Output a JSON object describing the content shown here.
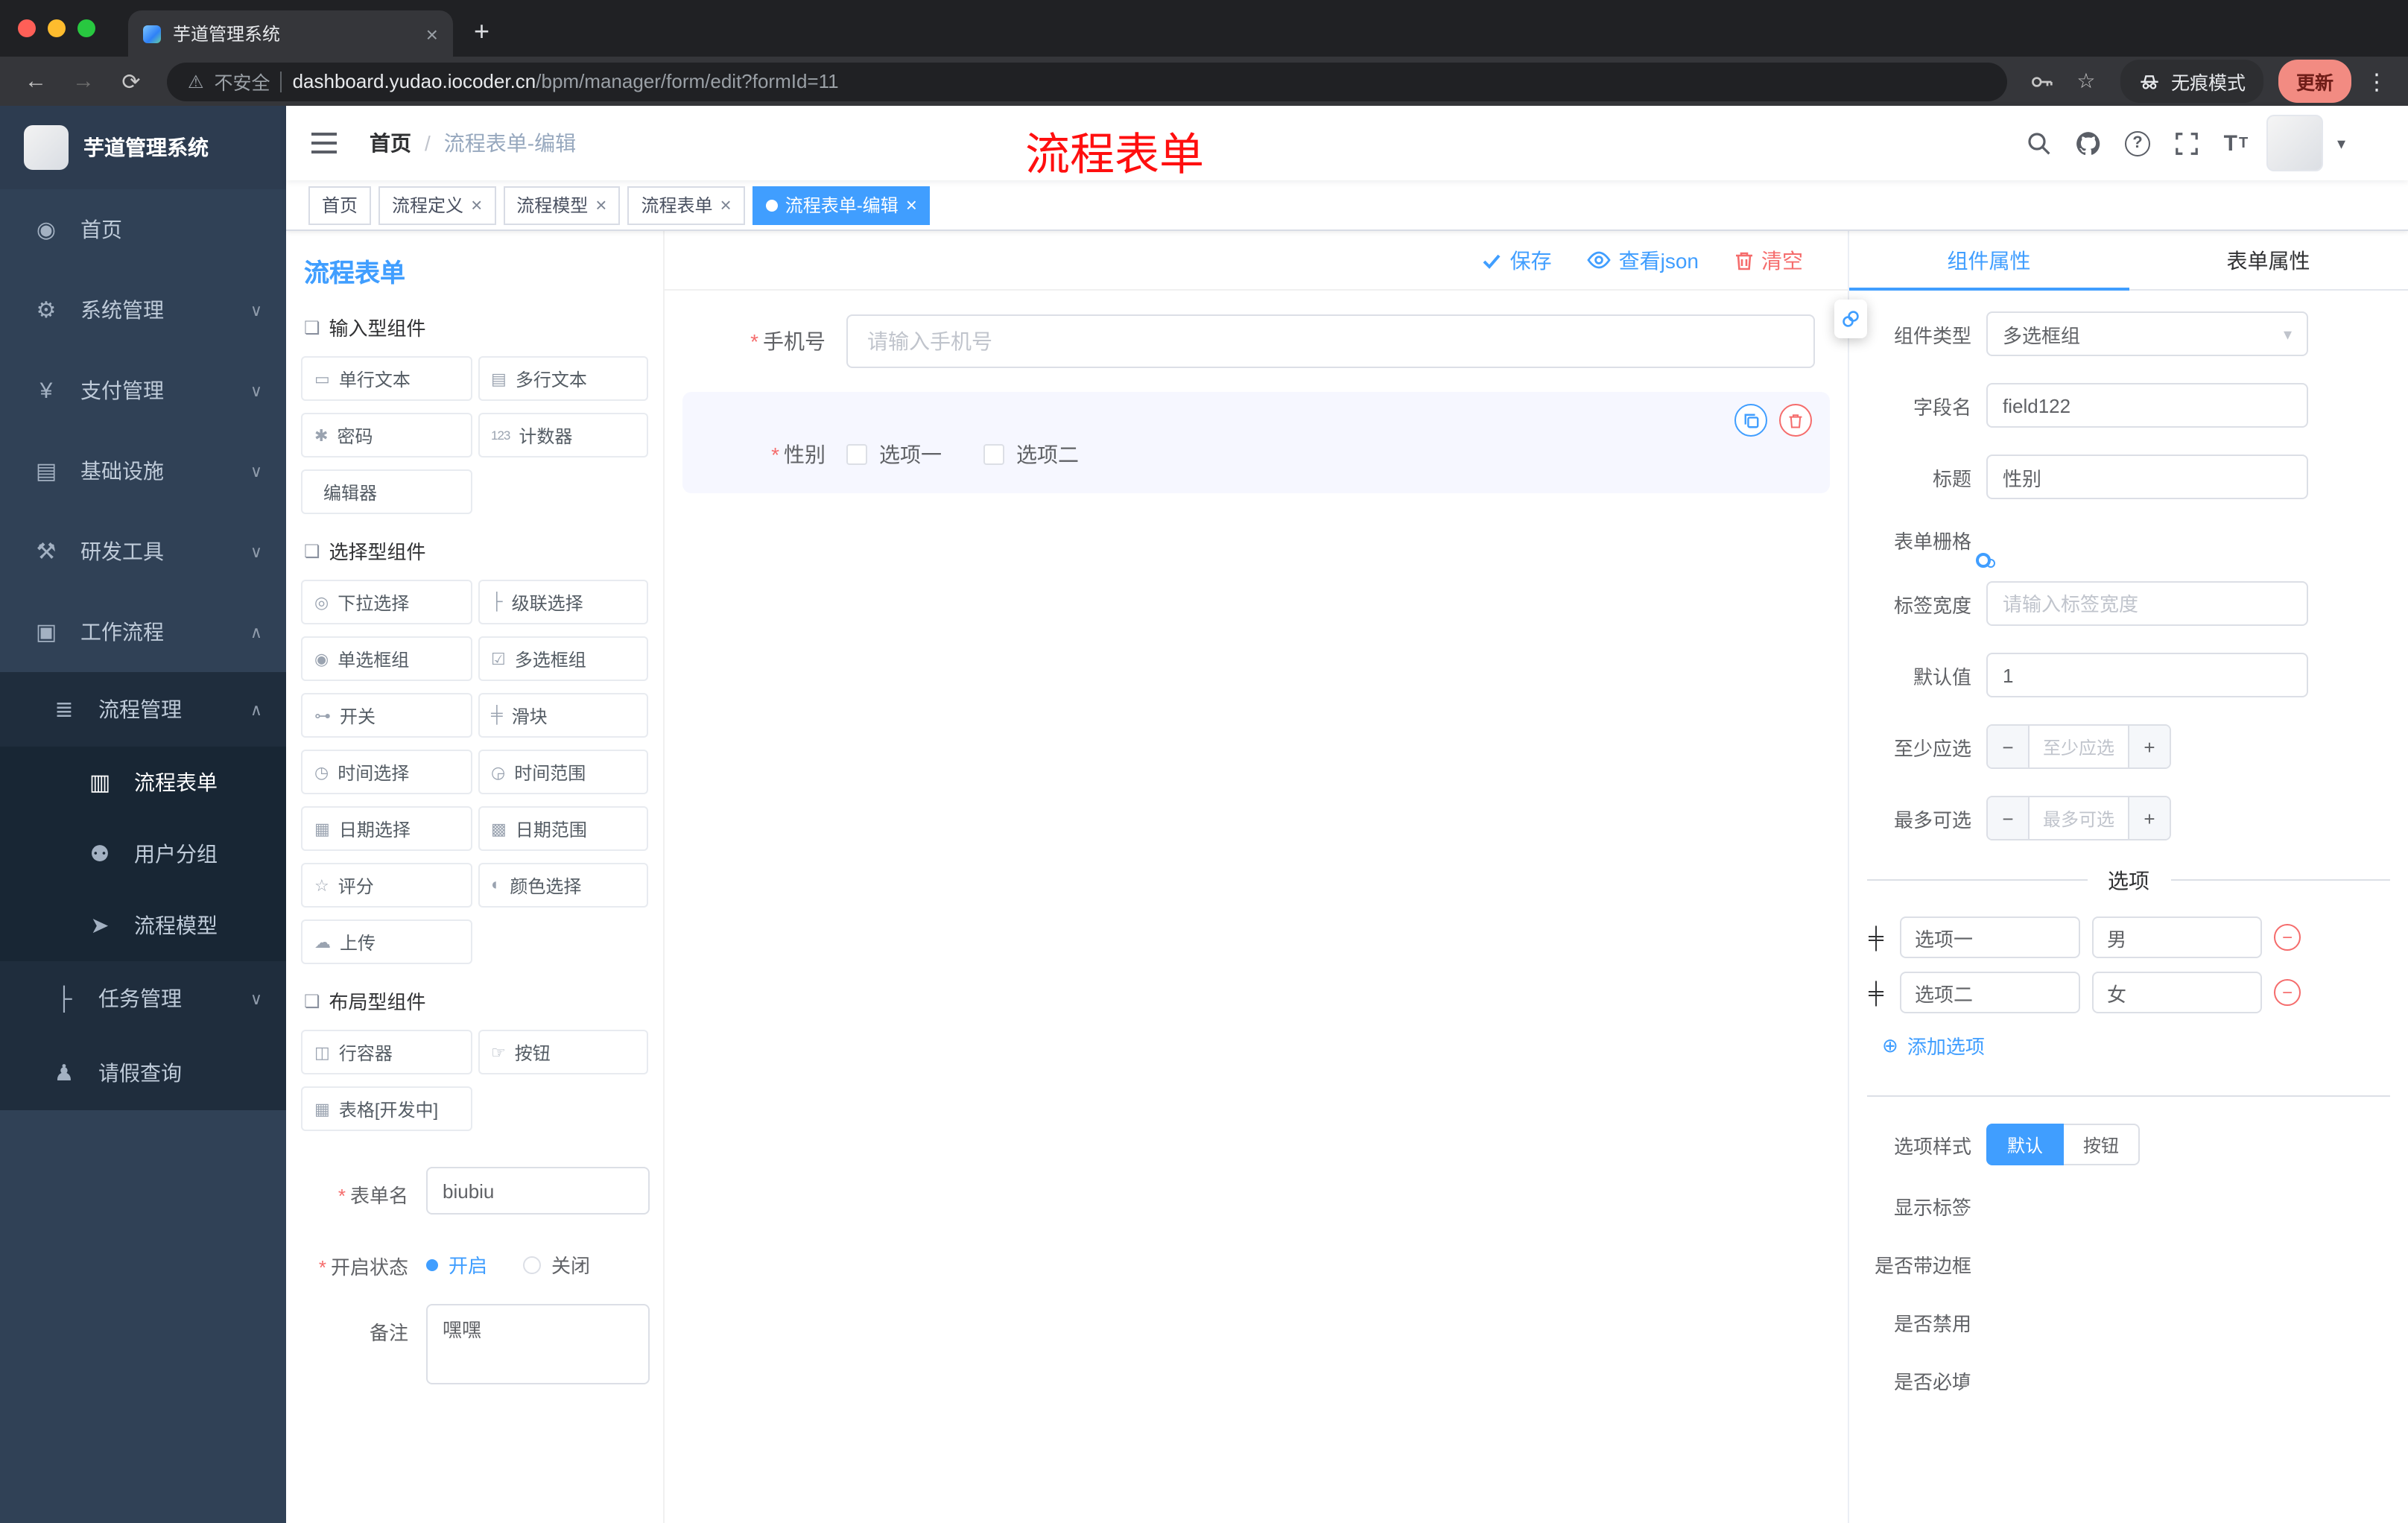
{
  "icons": {
    "close": "×",
    "new_tab": "+",
    "back": "←",
    "forward": "→",
    "reload": "⟳",
    "warning": "⚠",
    "star": "☆",
    "menu_dots": "⋮",
    "caret_down": "▾",
    "question": "?",
    "font_big": "T",
    "font_small": "T",
    "chevron_down": "∨",
    "chevron_up": "∧",
    "breadcrumb_sep": "/",
    "required": "*",
    "minus": "−",
    "plus": "+",
    "add_circle": "⊕",
    "remove_circle": "−",
    "drag_handle": "╪",
    "group_cube": "❏"
  },
  "browser": {
    "tab_title": "芋道管理系统",
    "security_label": "不安全",
    "url_host": "dashboard.yudao.iocoder.cn",
    "url_path": "/bpm/manager/form/edit?formId=11",
    "incognito_label": "无痕模式",
    "update_label": "更新"
  },
  "sidebar": {
    "logo_title": "芋道管理系统",
    "menu": [
      {
        "label": "首页",
        "icon": "◉"
      },
      {
        "label": "系统管理",
        "icon": "⚙"
      },
      {
        "label": "支付管理",
        "icon": "¥"
      },
      {
        "label": "基础设施",
        "icon": "▤"
      },
      {
        "label": "研发工具",
        "icon": "⚒"
      },
      {
        "label": "工作流程",
        "icon": "▣"
      }
    ],
    "submenu": [
      {
        "label": "流程管理",
        "icon": "≣"
      },
      {
        "label": "流程表单",
        "icon": "▥"
      },
      {
        "label": "用户分组",
        "icon": "⚉"
      },
      {
        "label": "流程模型",
        "icon": "➤"
      },
      {
        "label": "任务管理",
        "icon": "├"
      },
      {
        "label": "请假查询",
        "icon": "♟"
      }
    ]
  },
  "header": {
    "breadcrumb": [
      "首页",
      "流程表单-编辑"
    ],
    "annotation": "流程表单"
  },
  "tags": {
    "items": [
      {
        "label": "首页"
      },
      {
        "label": "流程定义"
      },
      {
        "label": "流程模型"
      },
      {
        "label": "流程表单"
      },
      {
        "label": "流程表单-编辑"
      }
    ]
  },
  "palette": {
    "title": "流程表单",
    "groups": [
      {
        "title": "输入型组件",
        "items": [
          {
            "icon": "▭",
            "label": "单行文本"
          },
          {
            "icon": "▤",
            "label": "多行文本"
          },
          {
            "icon": "✱",
            "label": "密码"
          },
          {
            "icon": "123",
            "label": "计数器"
          },
          {
            "icon": "",
            "label": "编辑器"
          }
        ]
      },
      {
        "title": "选择型组件",
        "items": [
          {
            "icon": "◎",
            "label": "下拉选择"
          },
          {
            "icon": "├",
            "label": "级联选择"
          },
          {
            "icon": "◉",
            "label": "单选框组"
          },
          {
            "icon": "☑",
            "label": "多选框组"
          },
          {
            "icon": "⊶",
            "label": "开关"
          },
          {
            "icon": "╪",
            "label": "滑块"
          },
          {
            "icon": "◷",
            "label": "时间选择"
          },
          {
            "icon": "◶",
            "label": "时间范围"
          },
          {
            "icon": "▦",
            "label": "日期选择"
          },
          {
            "icon": "▩",
            "label": "日期范围"
          },
          {
            "icon": "☆",
            "label": "评分"
          },
          {
            "icon": "◐",
            "label": "颜色选择"
          },
          {
            "icon": "☁",
            "label": "上传"
          }
        ]
      },
      {
        "title": "布局型组件",
        "items": [
          {
            "icon": "◫",
            "label": "行容器"
          },
          {
            "icon": "☞",
            "label": "按钮"
          },
          {
            "icon": "▦",
            "label": "表格[开发中]"
          }
        ]
      }
    ]
  },
  "form_meta": {
    "name_label": "表单名",
    "name_value": "biubiu",
    "status_label": "开启状态",
    "status_on": "开启",
    "status_off": "关闭",
    "remark_label": "备注",
    "remark_value": "嘿嘿"
  },
  "canvas": {
    "save_label": "保存",
    "view_json_label": "查看json",
    "clear_label": "清空",
    "phone": {
      "label": "手机号",
      "placeholder": "请输入手机号"
    },
    "gender": {
      "label": "性别",
      "option1": "选项一",
      "option2": "选项二"
    }
  },
  "properties": {
    "tab_component": "组件属性",
    "tab_form": "表单属性",
    "rows": {
      "type_label": "组件类型",
      "type_value": "多选框组",
      "field_label": "字段名",
      "field_value": "field122",
      "title_label": "标题",
      "title_value": "性别",
      "grid_label": "表单栅格",
      "label_width_label": "标签宽度",
      "label_width_placeholder": "请输入标签宽度",
      "default_label": "默认值",
      "default_value": "1",
      "min_label": "至少应选",
      "min_placeholder": "至少应选",
      "max_label": "最多可选",
      "max_placeholder": "最多可选"
    },
    "options": {
      "divider": "选项",
      "rows": [
        {
          "label": "选项一",
          "value": "男"
        },
        {
          "label": "选项二",
          "value": "女"
        }
      ],
      "add_label": "添加选项"
    },
    "style": {
      "option_style_label": "选项样式",
      "style_default": "默认",
      "style_button": "按钮",
      "show_label": "显示标签",
      "border_label": "是否带边框",
      "disabled_label": "是否禁用",
      "required_label": "是否必填"
    }
  },
  "colors": {
    "primary": "#409eff",
    "danger": "#f56c6c",
    "sidebar_bg": "#304156",
    "submenu_bg": "#1f2d3d",
    "annotation": "#ff0f0f",
    "active_tag": "#409eff"
  }
}
